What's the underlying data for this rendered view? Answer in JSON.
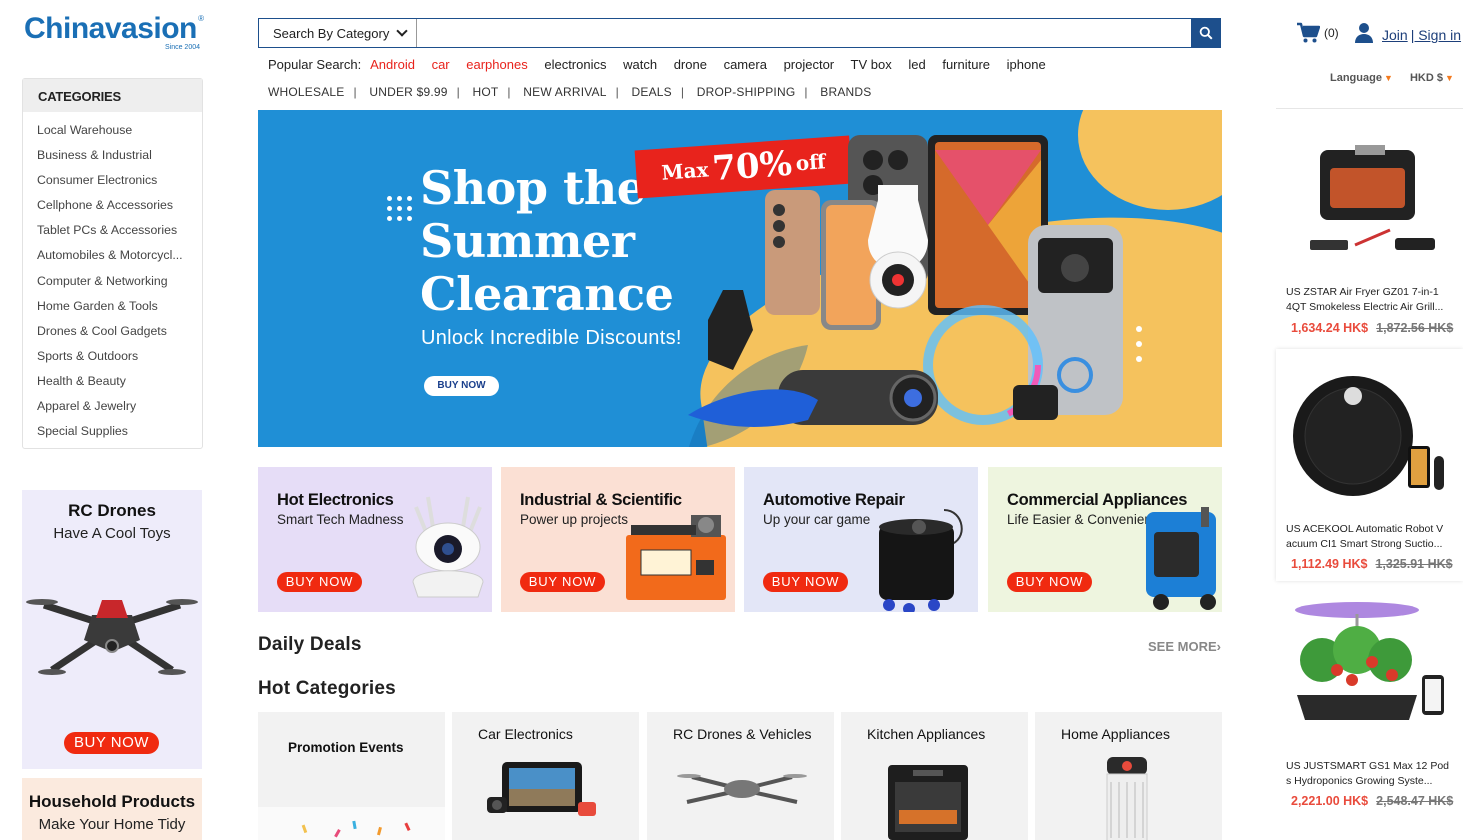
{
  "logo": {
    "text": "Chinavasion",
    "since": "Since 2004",
    "reg": "®"
  },
  "search": {
    "category_label": "Search By Category",
    "placeholder": "",
    "popular_label": "Popular Search:",
    "popular_terms": [
      "Android",
      "car",
      "earphones",
      "electronics",
      "watch",
      "drone",
      "camera",
      "projector",
      "TV box",
      "led",
      "furniture",
      "iphone"
    ]
  },
  "topnav": [
    "WHOLESALE",
    "UNDER $9.99",
    "HOT",
    "NEW ARRIVAL",
    "DEALS",
    "DROP-SHIPPING",
    "BRANDS"
  ],
  "header": {
    "cart_count": "(0)",
    "join_label": "Join",
    "signin_label": "| Sign in",
    "language_label": "Language",
    "currency_label": "HKD $"
  },
  "sidebar": {
    "title": "CATEGORIES",
    "items": [
      "Local Warehouse",
      "Business & Industrial",
      "Consumer Electronics",
      "Cellphone & Accessories",
      "Tablet PCs & Accessories",
      "Automobiles & Motorcycl...",
      "Computer & Networking",
      "Home Garden & Tools",
      "Drones & Cool Gadgets",
      "Sports & Outdoors",
      "Health & Beauty",
      "Apparel & Jewelry",
      "Special Supplies"
    ]
  },
  "promos": {
    "rc": {
      "title": "RC Drones",
      "subtitle": "Have A Cool Toys",
      "button": "BUY NOW"
    },
    "household": {
      "title": "Household Products",
      "subtitle": "Make Your Home Tidy"
    }
  },
  "hero": {
    "title_line1": "Shop the",
    "title_line2": "Summer",
    "title_line3": "Clearance",
    "subtitle": "Unlock Incredible Discounts!",
    "button": "BUY NOW",
    "sale_prefix": "Max",
    "sale_value": "70%",
    "sale_suffix": "off"
  },
  "tiles": [
    {
      "title": "Hot Electronics",
      "subtitle": "Smart Tech Madness",
      "button": "BUY NOW",
      "bg": "#e6ddf7"
    },
    {
      "title": "Industrial & Scientific",
      "subtitle": "Power up projects",
      "button": "BUY NOW",
      "bg": "#fbe0d4"
    },
    {
      "title": "Automotive Repair",
      "subtitle": "Up your car game",
      "button": "BUY NOW",
      "bg": "#e3e6f7"
    },
    {
      "title": "Commercial Appliances",
      "subtitle": "Life Easier & Convenient",
      "button": "BUY NOW",
      "bg": "#eef5df"
    }
  ],
  "sections": {
    "daily_deals": "Daily Deals",
    "see_more": "SEE MORE",
    "hot_categories": "Hot Categories"
  },
  "hot_categories": [
    "Promotion Events",
    "Car Electronics",
    "RC Drones & Vehicles",
    "Kitchen Appliances",
    "Home Appliances"
  ],
  "right_products": [
    {
      "name": "US ZSTAR Air Fryer GZ01 7-in-1 4QT Smokeless Electric Air Grill...",
      "price": "1,634.24 HK$",
      "old_price": "1,872.56 HK$"
    },
    {
      "name": "US ACEKOOL Automatic Robot V acuum CI1 Smart Strong Suctio...",
      "price": "1,112.49 HK$",
      "old_price": "1,325.91 HK$"
    },
    {
      "name": "US JUSTSMART GS1 Max 12 Pod s Hydroponics Growing Syste...",
      "price": "2,221.00 HK$",
      "old_price": "2,548.47 HK$"
    }
  ],
  "colors": {
    "brand": "#1a6fb5",
    "accent_red": "#e8231c",
    "button_red": "#f02a10",
    "price": "#e94b3c"
  }
}
